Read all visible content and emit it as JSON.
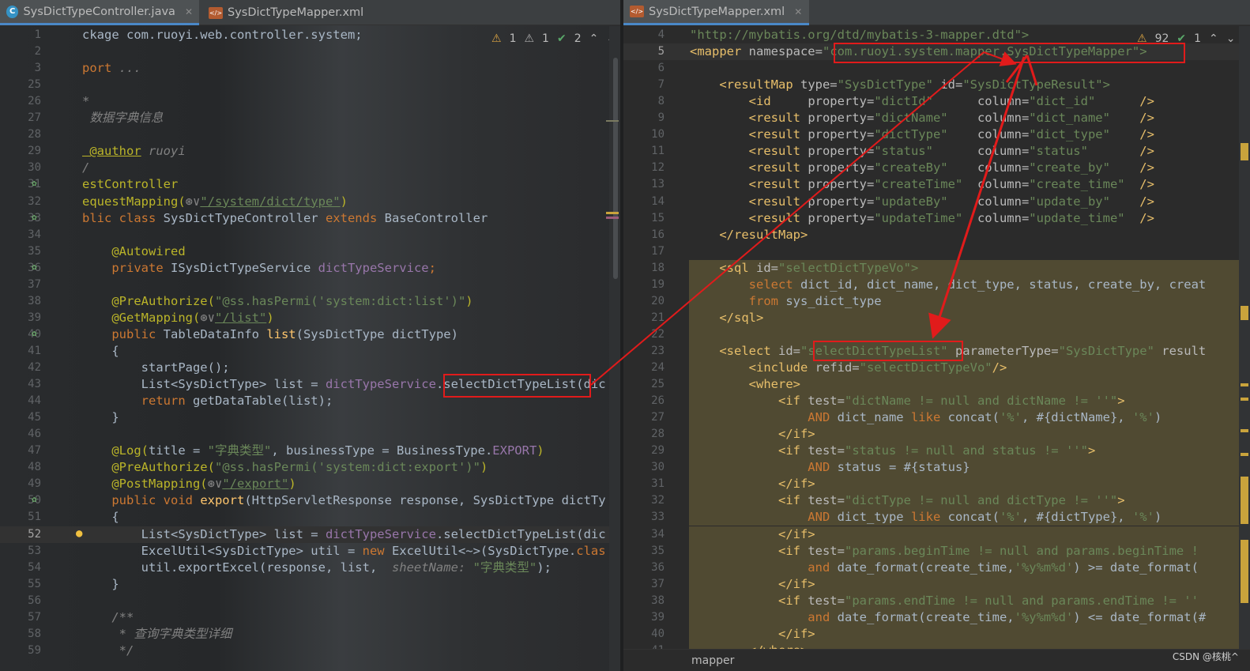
{
  "left_editor": {
    "tabs": [
      {
        "label": "SysDictTypeController.java",
        "icon": "java-class-icon",
        "active": true
      },
      {
        "label": "SysDictTypeMapper.xml",
        "icon": "xml-file-icon",
        "active": false
      }
    ],
    "inspections": {
      "warn": "1",
      "weak": "1",
      "ok": "2"
    },
    "lines": [
      {
        "n": "1",
        "segs": [
          [
            "ckage com.ruoyi.web.controller.system;",
            "ty"
          ]
        ]
      },
      {
        "n": "2",
        "segs": []
      },
      {
        "n": "3",
        "segs": [
          [
            "port ",
            "k"
          ],
          [
            "...",
            "cm"
          ]
        ]
      },
      {
        "n": "25",
        "segs": []
      },
      {
        "n": "26",
        "segs": [
          [
            "*",
            "cm"
          ]
        ]
      },
      {
        "n": "27",
        "segs": [
          [
            " 数据字典信息",
            "cm"
          ]
        ]
      },
      {
        "n": "28",
        "segs": []
      },
      {
        "n": "29",
        "segs": [
          [
            " @author",
            "an"
          ],
          [
            " ruoyi",
            "cm"
          ]
        ]
      },
      {
        "n": "30",
        "segs": [
          [
            "/",
            "cm"
          ]
        ]
      },
      {
        "n": "31",
        "segs": [
          [
            "estController",
            "an"
          ]
        ]
      },
      {
        "n": "32",
        "segs": [
          [
            "equestMapping(",
            "an"
          ],
          [
            "⊛∨",
            "cm"
          ],
          [
            "\"/system/dict/type\"",
            "s"
          ],
          [
            ")",
            "an"
          ]
        ]
      },
      {
        "n": "33",
        "segs": [
          [
            "blic class ",
            "k"
          ],
          [
            "SysDictTypeController ",
            "ty"
          ],
          [
            "extends ",
            "k"
          ],
          [
            "BaseController",
            "ty"
          ]
        ]
      },
      {
        "n": "34",
        "segs": []
      },
      {
        "n": "35",
        "segs": [
          [
            "    @Autowired",
            "an"
          ]
        ]
      },
      {
        "n": "36",
        "segs": [
          [
            "    private ",
            "k"
          ],
          [
            "ISysDictTypeService ",
            "ty"
          ],
          [
            "dictTypeService",
            "fld"
          ],
          [
            ";",
            "k"
          ]
        ]
      },
      {
        "n": "37",
        "segs": []
      },
      {
        "n": "38",
        "segs": [
          [
            "    @PreAuthorize(",
            "an"
          ],
          [
            "\"@ss.hasPermi(",
            "s"
          ],
          [
            "'system:dict:list'",
            "s"
          ],
          [
            ")\"",
            "s"
          ],
          [
            ")",
            "an"
          ]
        ]
      },
      {
        "n": "39",
        "segs": [
          [
            "    @GetMapping(",
            "an"
          ],
          [
            "⊛∨",
            "cm"
          ],
          [
            "\"/list\"",
            "s"
          ],
          [
            ")",
            "an"
          ]
        ]
      },
      {
        "n": "40",
        "segs": [
          [
            "    public ",
            "k"
          ],
          [
            "TableDataInfo ",
            "ty"
          ],
          [
            "list",
            "f"
          ],
          [
            "(SysDictType dictType)",
            "ty"
          ]
        ]
      },
      {
        "n": "41",
        "segs": [
          [
            "    {",
            "ty"
          ]
        ]
      },
      {
        "n": "42",
        "segs": [
          [
            "        startPage();",
            "ty"
          ]
        ]
      },
      {
        "n": "43",
        "segs": [
          [
            "        List<SysDictType> list = ",
            "ty"
          ],
          [
            "dictTypeService",
            "fld"
          ],
          [
            ".selectDictTypeList(dic",
            "ty"
          ]
        ]
      },
      {
        "n": "44",
        "segs": [
          [
            "        return ",
            "k"
          ],
          [
            "getDataTable(list);",
            "ty"
          ]
        ]
      },
      {
        "n": "45",
        "segs": [
          [
            "    }",
            "ty"
          ]
        ]
      },
      {
        "n": "46",
        "segs": []
      },
      {
        "n": "47",
        "segs": [
          [
            "    @Log(",
            "an"
          ],
          [
            "title = ",
            "ty"
          ],
          [
            "\"字典类型\"",
            "s"
          ],
          [
            ", businessType = BusinessType.",
            "ty"
          ],
          [
            "EXPORT",
            "fld"
          ],
          [
            ")",
            "an"
          ]
        ]
      },
      {
        "n": "48",
        "segs": [
          [
            "    @PreAuthorize(",
            "an"
          ],
          [
            "\"@ss.hasPermi(",
            "s"
          ],
          [
            "'system:dict:export'",
            "s"
          ],
          [
            ")\"",
            "s"
          ],
          [
            ")",
            "an"
          ]
        ]
      },
      {
        "n": "49",
        "segs": [
          [
            "    @PostMapping(",
            "an"
          ],
          [
            "⊛∨",
            "cm"
          ],
          [
            "\"/export\"",
            "s"
          ],
          [
            ")",
            "an"
          ]
        ]
      },
      {
        "n": "50",
        "segs": [
          [
            "    public void ",
            "k"
          ],
          [
            "export",
            "f"
          ],
          [
            "(HttpServletResponse response, SysDictType dictTy",
            "ty"
          ]
        ]
      },
      {
        "n": "51",
        "segs": [
          [
            "    {",
            "ty"
          ]
        ]
      },
      {
        "n": "52",
        "segs": [
          [
            "        List<SysDictType> list = ",
            "ty"
          ],
          [
            "dictTypeService",
            "fld"
          ],
          [
            ".selectDictTypeList(dic",
            "ty"
          ]
        ]
      },
      {
        "n": "53",
        "segs": [
          [
            "        ExcelUtil<SysDictType> util = ",
            "ty"
          ],
          [
            "new ",
            "k"
          ],
          [
            "ExcelUtil<~>(SysDictType.",
            "ty"
          ],
          [
            "clas",
            "k"
          ]
        ]
      },
      {
        "n": "54",
        "segs": [
          [
            "        util.exportExcel(response, list,  ",
            "ty"
          ],
          [
            "sheetName: ",
            "cm"
          ],
          [
            "\"字典类型\"",
            "s"
          ],
          [
            ");",
            "ty"
          ]
        ]
      },
      {
        "n": "55",
        "segs": [
          [
            "    }",
            "ty"
          ]
        ]
      },
      {
        "n": "56",
        "segs": []
      },
      {
        "n": "57",
        "segs": [
          [
            "    /**",
            "cm"
          ]
        ]
      },
      {
        "n": "58",
        "segs": [
          [
            "     * 查询字典类型详细",
            "cm"
          ]
        ]
      },
      {
        "n": "59",
        "segs": [
          [
            "     */",
            "cm"
          ]
        ]
      }
    ]
  },
  "right_editor": {
    "tabs": [
      {
        "label": "SysDictTypeMapper.xml",
        "icon": "xml-file-icon",
        "active": true
      }
    ],
    "inspections": {
      "warn": "92",
      "ok": "1"
    },
    "footer_breadcrumb": "mapper",
    "lines": [
      {
        "n": "4",
        "segs": [
          [
            "\"http://mybatis.org/dtd/mybatis-3-mapper.dtd\">",
            "av"
          ]
        ]
      },
      {
        "n": "5",
        "segs": [
          [
            "<mapper ",
            "tag"
          ],
          [
            "namespace=",
            "at"
          ],
          [
            "\"com.ruoyi.system.mapper.SysDictTypeMapper\">",
            "av"
          ]
        ]
      },
      {
        "n": "6",
        "segs": []
      },
      {
        "n": "7",
        "segs": [
          [
            "    <resultMap ",
            "tag"
          ],
          [
            "type=",
            "at"
          ],
          [
            "\"SysDictType\" ",
            "av"
          ],
          [
            "id=",
            "at"
          ],
          [
            "\"SysDictTypeResult\">",
            "av"
          ]
        ]
      },
      {
        "n": "8",
        "segs": [
          [
            "        <id     ",
            "tag"
          ],
          [
            "property=",
            "at"
          ],
          [
            "\"dictId\"      ",
            "av"
          ],
          [
            "column=",
            "at"
          ],
          [
            "\"dict_id\"      ",
            "av"
          ],
          [
            "/>",
            "tag"
          ]
        ]
      },
      {
        "n": "9",
        "segs": [
          [
            "        <result ",
            "tag"
          ],
          [
            "property=",
            "at"
          ],
          [
            "\"dictName\"    ",
            "av"
          ],
          [
            "column=",
            "at"
          ],
          [
            "\"dict_name\"    ",
            "av"
          ],
          [
            "/>",
            "tag"
          ]
        ]
      },
      {
        "n": "10",
        "segs": [
          [
            "        <result ",
            "tag"
          ],
          [
            "property=",
            "at"
          ],
          [
            "\"dictType\"    ",
            "av"
          ],
          [
            "column=",
            "at"
          ],
          [
            "\"dict_type\"    ",
            "av"
          ],
          [
            "/>",
            "tag"
          ]
        ]
      },
      {
        "n": "11",
        "segs": [
          [
            "        <result ",
            "tag"
          ],
          [
            "property=",
            "at"
          ],
          [
            "\"status\"      ",
            "av"
          ],
          [
            "column=",
            "at"
          ],
          [
            "\"status\"       ",
            "av"
          ],
          [
            "/>",
            "tag"
          ]
        ]
      },
      {
        "n": "12",
        "segs": [
          [
            "        <result ",
            "tag"
          ],
          [
            "property=",
            "at"
          ],
          [
            "\"createBy\"    ",
            "av"
          ],
          [
            "column=",
            "at"
          ],
          [
            "\"create_by\"    ",
            "av"
          ],
          [
            "/>",
            "tag"
          ]
        ]
      },
      {
        "n": "13",
        "segs": [
          [
            "        <result ",
            "tag"
          ],
          [
            "property=",
            "at"
          ],
          [
            "\"createTime\"  ",
            "av"
          ],
          [
            "column=",
            "at"
          ],
          [
            "\"create_time\"  ",
            "av"
          ],
          [
            "/>",
            "tag"
          ]
        ]
      },
      {
        "n": "14",
        "segs": [
          [
            "        <result ",
            "tag"
          ],
          [
            "property=",
            "at"
          ],
          [
            "\"updateBy\"    ",
            "av"
          ],
          [
            "column=",
            "at"
          ],
          [
            "\"update_by\"    ",
            "av"
          ],
          [
            "/>",
            "tag"
          ]
        ]
      },
      {
        "n": "15",
        "segs": [
          [
            "        <result ",
            "tag"
          ],
          [
            "property=",
            "at"
          ],
          [
            "\"updateTime\"  ",
            "av"
          ],
          [
            "column=",
            "at"
          ],
          [
            "\"update_time\"  ",
            "av"
          ],
          [
            "/>",
            "tag"
          ]
        ]
      },
      {
        "n": "16",
        "segs": [
          [
            "    </resultMap>",
            "tag"
          ]
        ]
      },
      {
        "n": "17",
        "segs": []
      },
      {
        "n": "18",
        "segs": [
          [
            "    <sql ",
            "tag"
          ],
          [
            "id=",
            "at"
          ],
          [
            "\"selectDictTypeVo\">",
            "av"
          ]
        ]
      },
      {
        "n": "19",
        "segs": [
          [
            "        select ",
            "k"
          ],
          [
            "dict_id, dict_name, dict_type, status, create_by, creat",
            "ty"
          ]
        ]
      },
      {
        "n": "20",
        "segs": [
          [
            "        from ",
            "k"
          ],
          [
            "sys_dict_type",
            "ty"
          ]
        ]
      },
      {
        "n": "21",
        "segs": [
          [
            "    </sql>",
            "tag"
          ]
        ]
      },
      {
        "n": "22",
        "segs": []
      },
      {
        "n": "23",
        "segs": [
          [
            "    <select ",
            "tag"
          ],
          [
            "id=",
            "at"
          ],
          [
            "\"selectDictTypeList\" ",
            "av"
          ],
          [
            "parameterType=",
            "at"
          ],
          [
            "\"SysDictType\" ",
            "av"
          ],
          [
            "result",
            "at"
          ]
        ]
      },
      {
        "n": "24",
        "segs": [
          [
            "        <include ",
            "tag"
          ],
          [
            "refid=",
            "at"
          ],
          [
            "\"selectDictTypeVo\"",
            "av"
          ],
          [
            "/>",
            "tag"
          ]
        ]
      },
      {
        "n": "25",
        "segs": [
          [
            "        <where>",
            "tag"
          ]
        ]
      },
      {
        "n": "26",
        "segs": [
          [
            "            <if ",
            "tag"
          ],
          [
            "test=",
            "at"
          ],
          [
            "\"dictName != null and dictName != ''\"",
            "av"
          ],
          [
            ">",
            "tag"
          ]
        ]
      },
      {
        "n": "27",
        "segs": [
          [
            "                AND ",
            "k"
          ],
          [
            "dict_name ",
            "ty"
          ],
          [
            "like ",
            "k"
          ],
          [
            "concat(",
            "ty"
          ],
          [
            "'%'",
            "s"
          ],
          [
            ", #{dictName}, ",
            "ty"
          ],
          [
            "'%'",
            "s"
          ],
          [
            ")",
            "ty"
          ]
        ]
      },
      {
        "n": "28",
        "segs": [
          [
            "            </if>",
            "tag"
          ]
        ]
      },
      {
        "n": "29",
        "segs": [
          [
            "            <if ",
            "tag"
          ],
          [
            "test=",
            "at"
          ],
          [
            "\"status != null and status != ''\"",
            "av"
          ],
          [
            ">",
            "tag"
          ]
        ]
      },
      {
        "n": "30",
        "segs": [
          [
            "                AND ",
            "k"
          ],
          [
            "status = #{status}",
            "ty"
          ]
        ]
      },
      {
        "n": "31",
        "segs": [
          [
            "            </if>",
            "tag"
          ]
        ]
      },
      {
        "n": "32",
        "segs": [
          [
            "            <if ",
            "tag"
          ],
          [
            "test=",
            "at"
          ],
          [
            "\"dictType != null and dictType != ''\"",
            "av"
          ],
          [
            ">",
            "tag"
          ]
        ]
      },
      {
        "n": "33",
        "segs": [
          [
            "                AND ",
            "k"
          ],
          [
            "dict_type ",
            "ty"
          ],
          [
            "like ",
            "k"
          ],
          [
            "concat(",
            "ty"
          ],
          [
            "'%'",
            "s"
          ],
          [
            ", #{dictType}, ",
            "ty"
          ],
          [
            "'%'",
            "s"
          ],
          [
            ")",
            "ty"
          ]
        ]
      },
      {
        "n": "34",
        "segs": [
          [
            "            </if>",
            "tag"
          ]
        ]
      },
      {
        "n": "35",
        "segs": [
          [
            "            <if ",
            "tag"
          ],
          [
            "test=",
            "at"
          ],
          [
            "\"params.beginTime != null and params.beginTime !",
            "av"
          ]
        ]
      },
      {
        "n": "36",
        "segs": [
          [
            "                and ",
            "k"
          ],
          [
            "date_format(create_time,",
            "ty"
          ],
          [
            "'%y%m%d'",
            "s"
          ],
          [
            ") >= date_format(",
            "ty"
          ]
        ]
      },
      {
        "n": "37",
        "segs": [
          [
            "            </if>",
            "tag"
          ]
        ]
      },
      {
        "n": "38",
        "segs": [
          [
            "            <if ",
            "tag"
          ],
          [
            "test=",
            "at"
          ],
          [
            "\"params.endTime != null and params.endTime != ''",
            "av"
          ]
        ]
      },
      {
        "n": "39",
        "segs": [
          [
            "                and ",
            "k"
          ],
          [
            "date_format(create_time,",
            "ty"
          ],
          [
            "'%y%m%d'",
            "s"
          ],
          [
            ") <= date_format(#",
            "ty"
          ]
        ]
      },
      {
        "n": "40",
        "segs": [
          [
            "            </if>",
            "tag"
          ]
        ]
      },
      {
        "n": "41",
        "segs": [
          [
            "        </where>",
            "tag"
          ]
        ]
      }
    ]
  },
  "watermark": "CSDN @核桃^"
}
